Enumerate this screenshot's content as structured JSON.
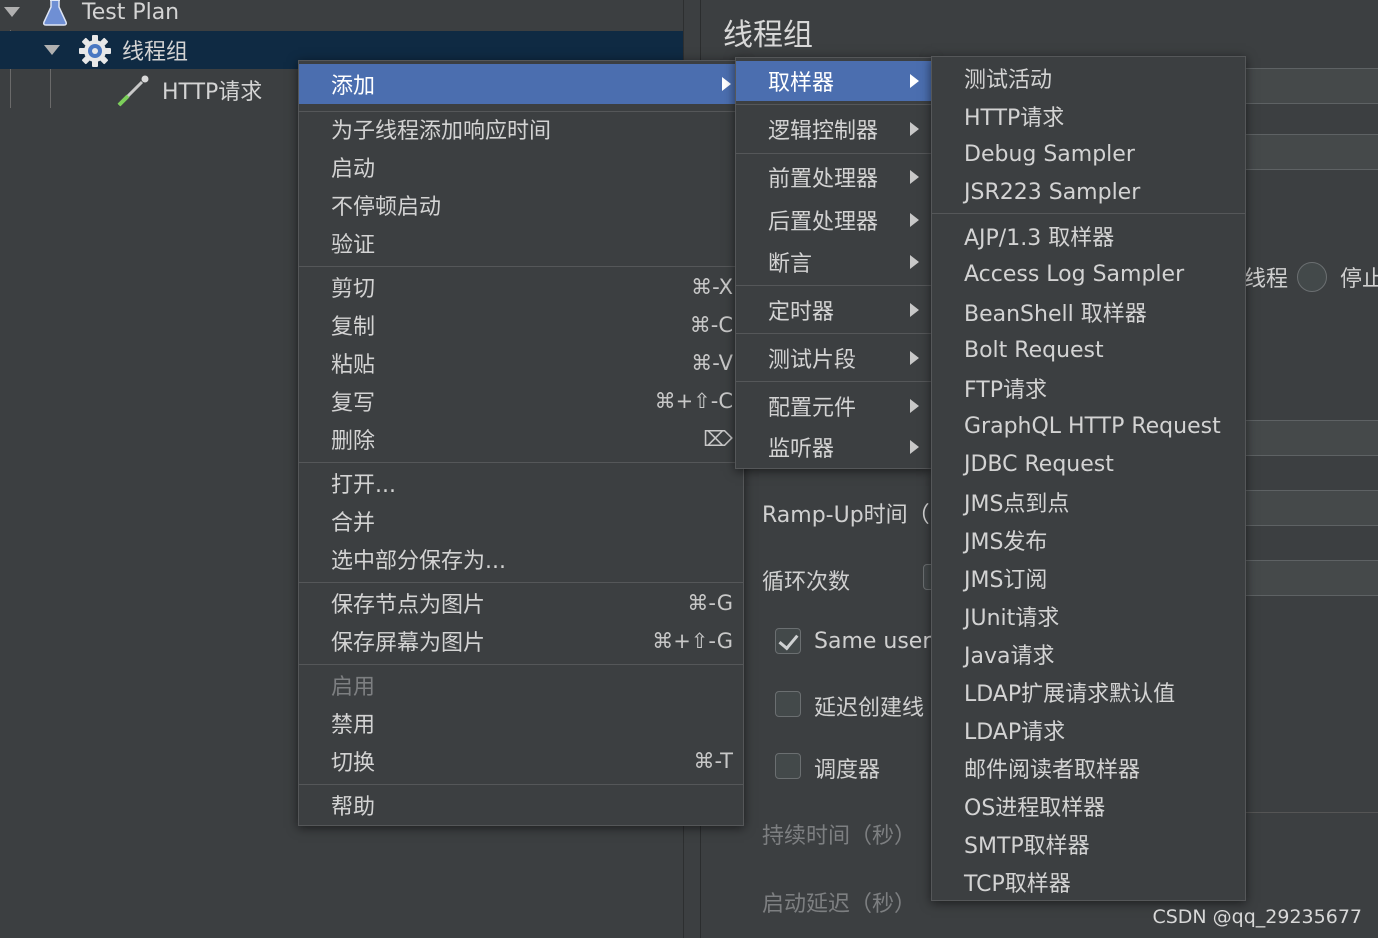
{
  "tree": {
    "test_plan": "Test Plan",
    "thread_group": "线程组",
    "http_request": "HTTP请求"
  },
  "right_panel": {
    "title": "线程组",
    "partial_thread_label": "线程",
    "partial_stop_label": "停止",
    "ramp_up_label": "Ramp-Up时间（",
    "loop_label": "循环次数",
    "same_user_label": "Same user",
    "same_user_checked": true,
    "delay_create_label": "延迟创建线",
    "delay_create_checked": false,
    "scheduler_label": "调度器",
    "scheduler_checked": false,
    "duration_label": "持续时间（秒）",
    "startup_delay_label": "启动延迟（秒）"
  },
  "context_menu": {
    "add": "添加",
    "group1": [
      "为子线程添加响应时间",
      "启动",
      "不停顿启动",
      "验证"
    ],
    "group2": [
      {
        "label": "剪切",
        "shortcut": "⌘-X"
      },
      {
        "label": "复制",
        "shortcut": "⌘-C"
      },
      {
        "label": "粘贴",
        "shortcut": "⌘-V"
      },
      {
        "label": "复写",
        "shortcut": "⌘+⇧-C"
      },
      {
        "label": "删除",
        "shortcut": "⌦"
      }
    ],
    "group3": [
      "打开...",
      "合并",
      "选中部分保存为..."
    ],
    "group4": [
      {
        "label": "保存节点为图片",
        "shortcut": "⌘-G"
      },
      {
        "label": "保存屏幕为图片",
        "shortcut": "⌘+⇧-G"
      }
    ],
    "group5": [
      {
        "label": "启用",
        "shortcut": "",
        "disabled": true
      },
      {
        "label": "禁用",
        "shortcut": "",
        "disabled": false
      },
      {
        "label": "切换",
        "shortcut": "⌘-T",
        "disabled": false
      }
    ],
    "help": "帮助"
  },
  "add_submenu": {
    "items": [
      "取样器",
      "逻辑控制器",
      "前置处理器",
      "后置处理器",
      "断言",
      "定时器",
      "测试片段",
      "配置元件",
      "监听器"
    ]
  },
  "sampler_submenu": {
    "group1": [
      "测试活动",
      "HTTP请求",
      "Debug Sampler",
      "JSR223 Sampler"
    ],
    "group2": [
      "AJP/1.3 取样器",
      "Access Log Sampler",
      "BeanShell 取样器",
      "Bolt Request",
      "FTP请求",
      "GraphQL HTTP Request",
      "JDBC Request",
      "JMS点到点",
      "JMS发布",
      "JMS订阅",
      "JUnit请求",
      "Java请求",
      "LDAP扩展请求默认值",
      "LDAP请求",
      "邮件阅读者取样器",
      "OS进程取样器",
      "SMTP取样器",
      "TCP取样器"
    ]
  },
  "watermark": "CSDN @qq_29235677",
  "colors": {
    "background": "#3c3f41",
    "highlight": "#4b6eaf",
    "tree_selection": "#0f2a43"
  }
}
